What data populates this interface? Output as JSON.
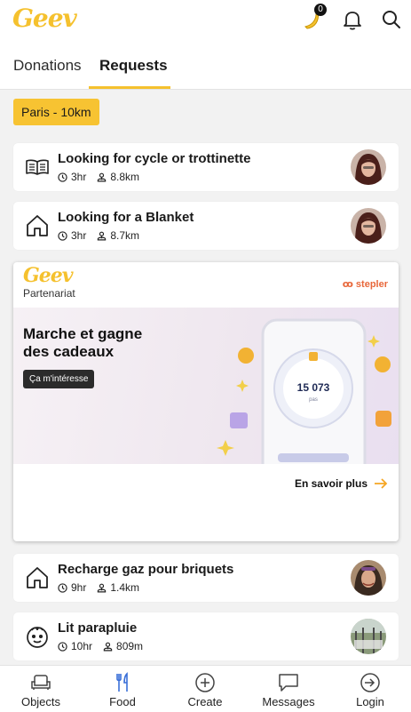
{
  "header": {
    "logo": "Geev",
    "banana_count": "0"
  },
  "tabs": [
    {
      "label": "Donations",
      "active": false
    },
    {
      "label": "Requests",
      "active": true
    }
  ],
  "location_filter": "Paris - 10km",
  "requests_top": [
    {
      "title": "Looking for cycle or trottinette",
      "time": "3hr",
      "distance": "8.8km",
      "icon": "book-icon"
    },
    {
      "title": "Looking for a Blanket",
      "time": "3hr",
      "distance": "8.7km",
      "icon": "house-icon"
    }
  ],
  "ad": {
    "logo": "Geev",
    "partner_label": "Partenariat",
    "brand": "stepler",
    "headline_line1": "Marche et gagne",
    "headline_line2": "des cadeaux",
    "cta": "Ça m'intéresse",
    "phone_steps": "15 073",
    "phone_unit": "pas",
    "more_link": "En savoir plus"
  },
  "requests_bottom": [
    {
      "title": "Recharge gaz pour briquets",
      "time": "9hr",
      "distance": "1.4km",
      "icon": "house-icon"
    },
    {
      "title": "Lit parapluie",
      "time": "10hr",
      "distance": "809m",
      "icon": "baby-icon"
    }
  ],
  "bottom_nav": [
    {
      "label": "Objects",
      "icon": "sofa-icon",
      "active": false
    },
    {
      "label": "Food",
      "icon": "cutlery-icon",
      "active": false
    },
    {
      "label": "Create",
      "icon": "plus-circle-icon",
      "active": false
    },
    {
      "label": "Messages",
      "icon": "chat-icon",
      "active": false
    },
    {
      "label": "Login",
      "icon": "login-icon",
      "active": false
    }
  ],
  "colors": {
    "brand_yellow": "#f5c12e",
    "accent_blue": "#3a6fd8",
    "stepler_orange": "#e8673a"
  }
}
